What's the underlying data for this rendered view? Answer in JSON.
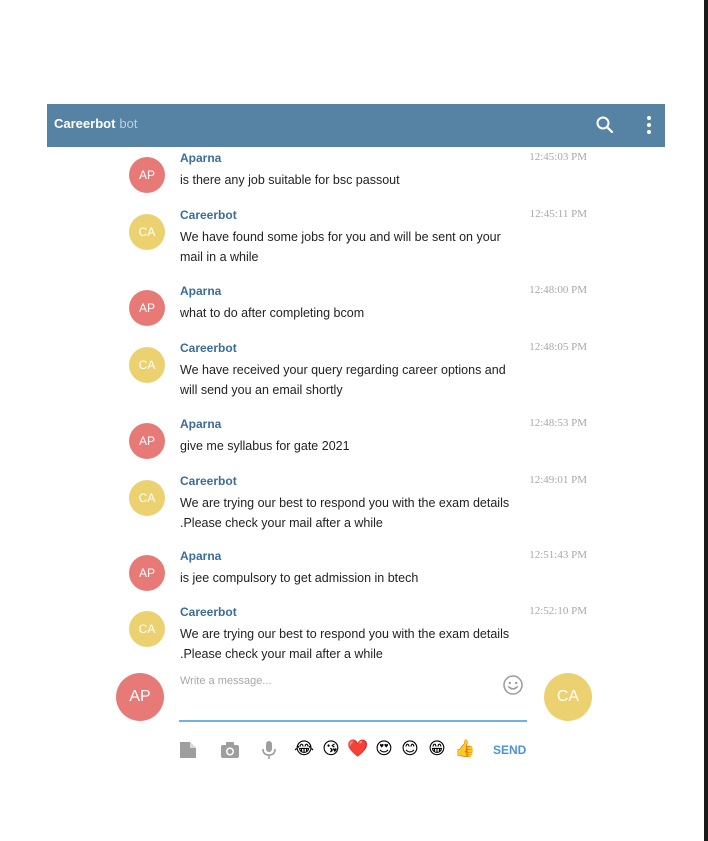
{
  "header": {
    "title": "Careerbot",
    "subtitle": "bot"
  },
  "messages": [
    {
      "avatar": "AP",
      "author": "Aparna",
      "time": "12:45:03 PM",
      "text": "is there any job suitable for bsc passout"
    },
    {
      "avatar": "CA",
      "author": "Careerbot",
      "time": "12:45:11 PM",
      "text": "We have found some jobs for you and will be sent on your mail in a while"
    },
    {
      "avatar": "AP",
      "author": "Aparna",
      "time": "12:48:00 PM",
      "text": "what to do after completing bcom"
    },
    {
      "avatar": "CA",
      "author": "Careerbot",
      "time": "12:48:05 PM",
      "text": "We have received your query regarding career options and will send you an email shortly"
    },
    {
      "avatar": "AP",
      "author": "Aparna",
      "time": "12:48:53 PM",
      "text": "give me syllabus for gate 2021"
    },
    {
      "avatar": "CA",
      "author": "Careerbot",
      "time": "12:49:01 PM",
      "text": "We are trying our best to respond you with the exam details .Please check your mail after a while"
    },
    {
      "avatar": "AP",
      "author": "Aparna",
      "time": "12:51:43 PM",
      "text": "is jee compulsory to get admission in btech"
    },
    {
      "avatar": "CA",
      "author": "Careerbot",
      "time": "12:52:10 PM",
      "text": "We are trying our best to respond you with the exam details .Please check your mail after a while"
    }
  ],
  "composer": {
    "user_avatar": "AP",
    "bot_avatar": "CA",
    "placeholder": "Write a message...",
    "value": "",
    "send_label": "SEND",
    "emojis": [
      "😂",
      "😘",
      "❤️",
      "😍",
      "😊",
      "😁",
      "👍"
    ]
  },
  "colors": {
    "header": "#5682a3",
    "user_avatar": "#e77a77",
    "bot_avatar": "#ecd170",
    "author": "#3a6d99",
    "send": "#4a95d6",
    "input_underline": "#6fb1e3"
  },
  "icons": {
    "header": [
      "search-icon",
      "more-vertical-icon"
    ],
    "composer": [
      "smile-icon",
      "file-icon",
      "camera-icon",
      "microphone-icon"
    ]
  }
}
